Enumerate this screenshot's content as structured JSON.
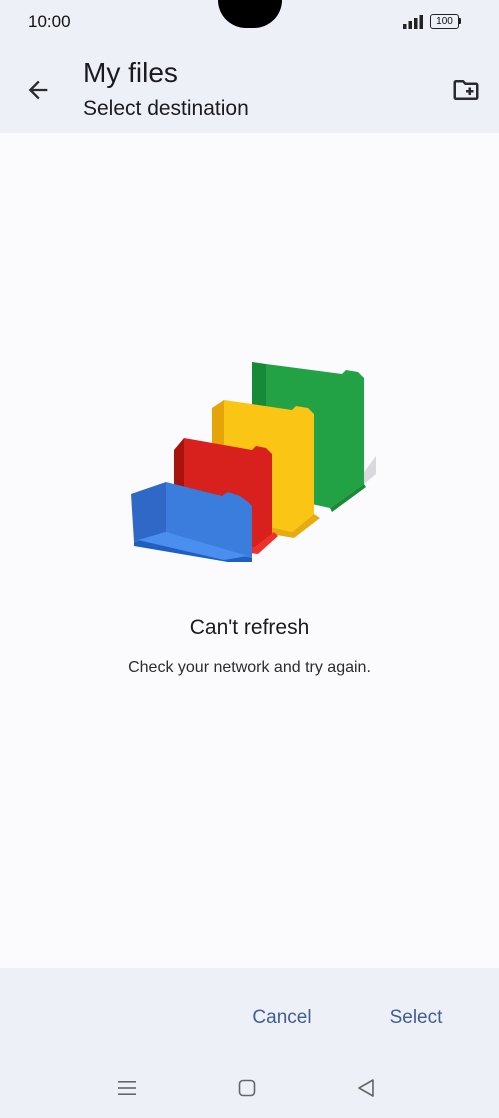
{
  "status_bar": {
    "time": "10:00",
    "battery": "100",
    "icons": [
      "signal-icon",
      "battery-icon"
    ]
  },
  "app_bar": {
    "title": "My files",
    "subtitle": "Select destination",
    "icons": [
      "arrow-back-icon",
      "create-new-folder-icon"
    ]
  },
  "empty_state": {
    "title": "Can't refresh",
    "message": "Check your network and try again.",
    "icon": "folders-illustration",
    "colors": {
      "blue": "#3b7ddd",
      "red": "#d8201c",
      "yellow": "#fbc515",
      "green": "#22a245"
    }
  },
  "actions": {
    "cancel_label": "Cancel",
    "select_label": "Select",
    "accent_color": "#3f5f90"
  },
  "nav_bar": {
    "icons": [
      "menu-icon",
      "home-square-icon",
      "back-triangle-icon"
    ]
  }
}
